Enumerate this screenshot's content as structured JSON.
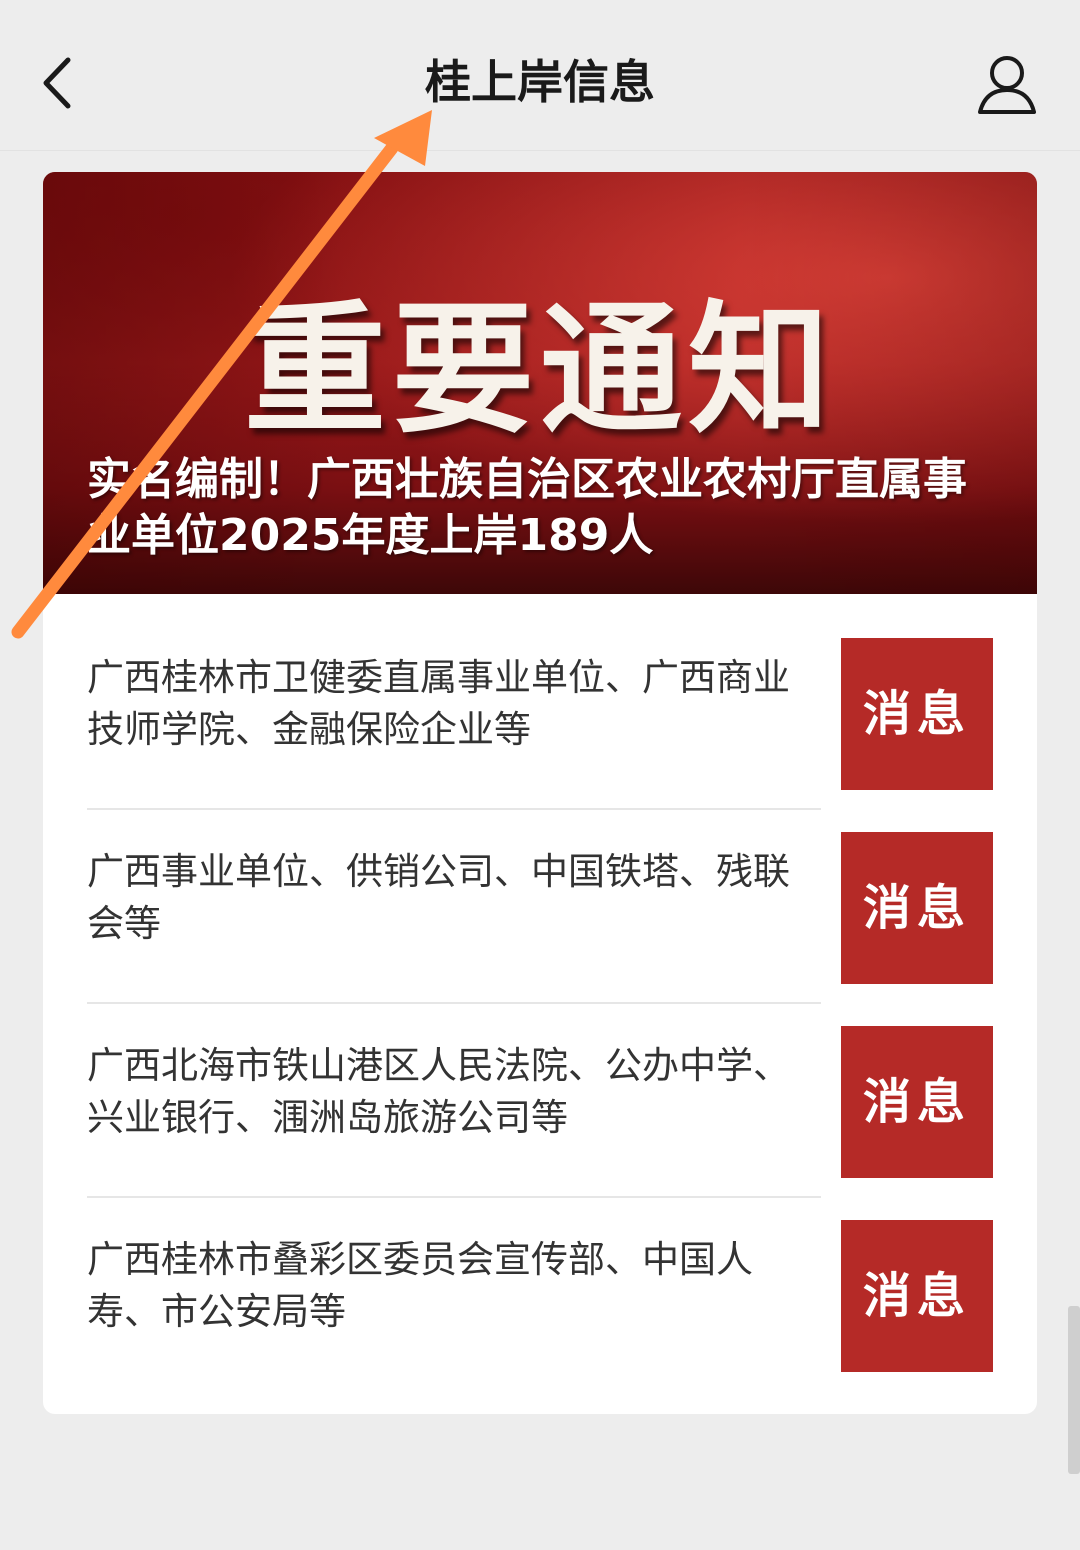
{
  "header": {
    "title": "桂上岸信息",
    "back_icon": "chevron-left-icon",
    "profile_icon": "user-icon"
  },
  "banner": {
    "heading": "重要通知",
    "subtitle": "实名编制！广西壮族自治区农业农村厅直属事业单位2025年度上岸189人",
    "colors": {
      "primary_red": "#9e1b1c",
      "highlight_red": "#e4463c"
    }
  },
  "list": {
    "items": [
      {
        "text": "广西桂林市卫健委直属事业单位、广西商业技师学院、金融保险企业等",
        "tag": "消息"
      },
      {
        "text": "广西事业单位、供销公司、中国铁塔、残联会等",
        "tag": "消息"
      },
      {
        "text": "广西北海市铁山港区人民法院、公办中学、兴业银行、涠洲岛旅游公司等",
        "tag": "消息"
      },
      {
        "text": "广西桂林市叠彩区委员会宣传部、中国人寿、市公安局等",
        "tag": "消息"
      }
    ],
    "tag_color": "#b52a27"
  },
  "annotation": {
    "color": "#ff8a3d"
  }
}
